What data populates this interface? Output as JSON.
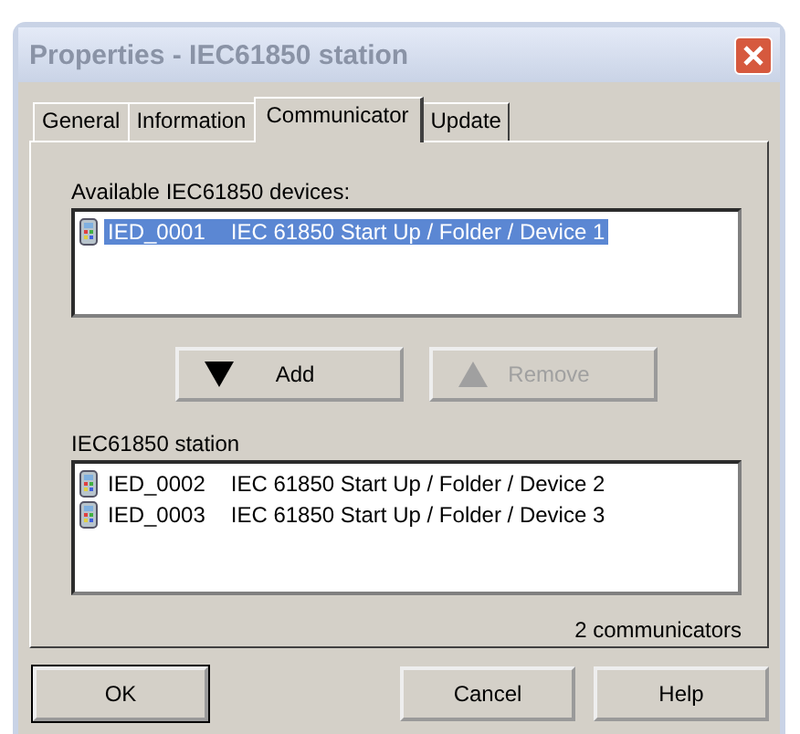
{
  "window": {
    "title": "Properties - IEC61850 station",
    "active": false
  },
  "tabs": [
    {
      "label": "General",
      "selected": false
    },
    {
      "label": "Information",
      "selected": false
    },
    {
      "label": "Communicator",
      "selected": true
    },
    {
      "label": "Update",
      "selected": false
    }
  ],
  "available": {
    "label": "Available IEC61850 devices:",
    "items": [
      {
        "id": "IED_0001",
        "path": "IEC 61850 Start Up / Folder / Device 1",
        "selected": true
      }
    ]
  },
  "buttons_mid": [
    {
      "label": "Add",
      "kind": "down",
      "disabled": false
    },
    {
      "label": "Remove",
      "kind": "up",
      "disabled": true
    }
  ],
  "station": {
    "label": "IEC61850 station",
    "items": [
      {
        "id": "IED_0002",
        "path": "IEC 61850 Start Up / Folder / Device 2",
        "selected": false
      },
      {
        "id": "IED_0003",
        "path": "IEC 61850 Start Up / Folder / Device 3",
        "selected": false
      }
    ]
  },
  "count": "2 communicators",
  "buttons": [
    {
      "label": "OK",
      "default": true
    },
    {
      "label": "Cancel",
      "default": false
    },
    {
      "label": "Help",
      "default": false
    }
  ]
}
